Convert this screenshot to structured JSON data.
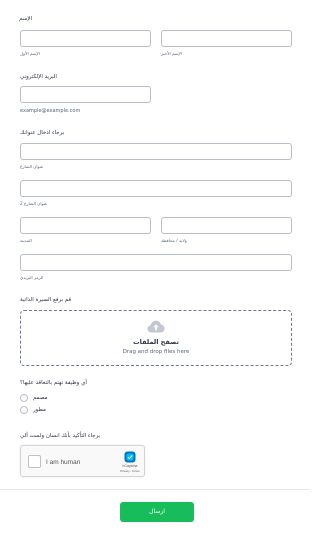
{
  "name": {
    "label": "الإسم",
    "first_sub": "الإسم الأول",
    "last_sub": "الإسم الأخير"
  },
  "email": {
    "label": "البريد الإلكتروني",
    "hint": "example@example.com"
  },
  "address": {
    "label": "برجاء ادخال عنوانك",
    "street_sub": "عنوان الشارع",
    "street2_sub": "عنوان الشارع 2",
    "city_sub": "المدينة",
    "state_sub": "ولاية / محافظة",
    "zip_sub": "الرمز البريدي"
  },
  "upload": {
    "label": "قم برفع السيرة الذاتية",
    "title": "تصفح الملفات",
    "subtitle": "Drag and drop files here"
  },
  "role": {
    "label": "أي وظيفة تهتم بالتعاقد عليها؟",
    "options": [
      "مصمم",
      "مطور"
    ]
  },
  "human": {
    "label": "برجاء التأكيد بأنك انسان ولست آلي",
    "captcha_text": "I am human",
    "captcha_brand": "hCaptcha",
    "captcha_links": "Privacy - Terms"
  },
  "submit": {
    "label": "ارسال"
  },
  "colors": {
    "accent": "#18bd5b",
    "border": "#b8bdc9",
    "upload_border": "#6f76a7"
  }
}
